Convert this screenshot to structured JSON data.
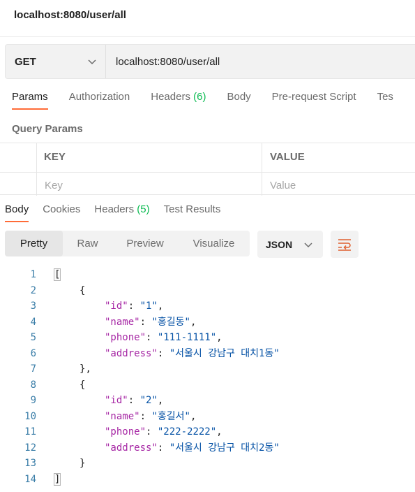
{
  "request": {
    "title": "localhost:8080/user/all",
    "method": "GET",
    "url": "localhost:8080/user/all"
  },
  "request_tabs": [
    {
      "label": "Params",
      "count": "",
      "active": true
    },
    {
      "label": "Authorization",
      "count": ""
    },
    {
      "label": "Headers ",
      "count": "(6)"
    },
    {
      "label": "Body",
      "count": ""
    },
    {
      "label": "Pre-request Script",
      "count": ""
    },
    {
      "label": "Tes",
      "count": ""
    }
  ],
  "query_params": {
    "title": "Query Params",
    "key_header": "KEY",
    "value_header": "VALUE",
    "key_placeholder": "Key",
    "value_placeholder": "Value"
  },
  "response_tabs": [
    {
      "label": "Body",
      "count": "",
      "active": true
    },
    {
      "label": "Cookies",
      "count": ""
    },
    {
      "label": "Headers ",
      "count": "(5)"
    },
    {
      "label": "Test Results",
      "count": ""
    }
  ],
  "view_modes": [
    "Pretty",
    "Raw",
    "Preview",
    "Visualize"
  ],
  "active_view": "Pretty",
  "format": "JSON",
  "icons": {
    "method_dropdown": "chevron-down-icon",
    "format_dropdown": "chevron-down-icon",
    "wrap": "wrap-lines-icon"
  },
  "colors": {
    "accent": "#ff6c37",
    "count": "#0cbb52",
    "json_key": "#a626a4",
    "json_string": "#0451a5",
    "line_number": "#3b7ea8"
  },
  "code_lines": [
    {
      "n": "1",
      "open": "[",
      "close": ""
    },
    {
      "n": "2",
      "open": "{",
      "close": ""
    },
    {
      "n": "3",
      "key": "\"id\"",
      "value": "\"1\"",
      "tail": ","
    },
    {
      "n": "4",
      "key": "\"name\"",
      "value": "\"홍길동\"",
      "tail": ","
    },
    {
      "n": "5",
      "key": "\"phone\"",
      "value": "\"111-1111\"",
      "tail": ","
    },
    {
      "n": "6",
      "key": "\"address\"",
      "value": "\"서울시 강남구 대치1동\"",
      "tail": ""
    },
    {
      "n": "7",
      "open": "}",
      "close": ","
    },
    {
      "n": "8",
      "open": "{",
      "close": ""
    },
    {
      "n": "9",
      "key": "\"id\"",
      "value": "\"2\"",
      "tail": ","
    },
    {
      "n": "10",
      "key": "\"name\"",
      "value": "\"홍길서\"",
      "tail": ","
    },
    {
      "n": "11",
      "key": "\"phone\"",
      "value": "\"222-2222\"",
      "tail": ","
    },
    {
      "n": "12",
      "key": "\"address\"",
      "value": "\"서울시 강남구 대치2동\"",
      "tail": ""
    },
    {
      "n": "13",
      "open": "}",
      "close": ""
    },
    {
      "n": "14",
      "open": "]",
      "close": ""
    }
  ]
}
